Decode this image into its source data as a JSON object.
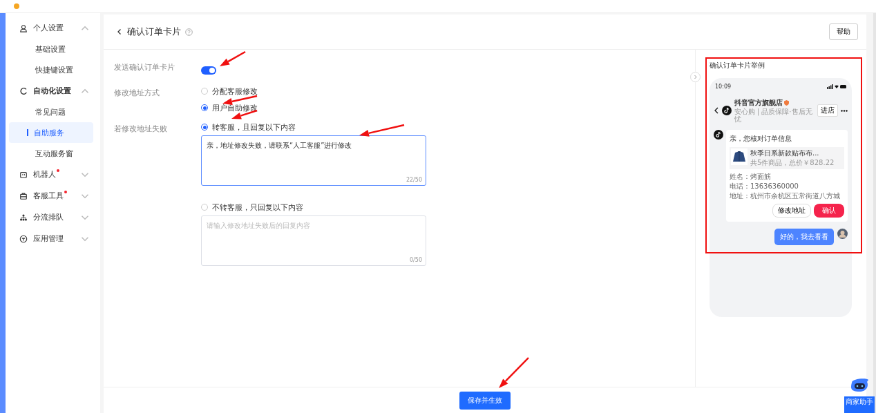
{
  "sidebar": {
    "groups": [
      {
        "label": "个人设置",
        "expanded": true,
        "dot": false,
        "children": [
          {
            "label": "基础设置",
            "selected": false
          },
          {
            "label": "快捷键设置",
            "selected": false
          }
        ]
      },
      {
        "label": "自动化设置",
        "expanded": true,
        "dot": false,
        "children": [
          {
            "label": "常见问题",
            "selected": false
          },
          {
            "label": "自助服务",
            "selected": true
          },
          {
            "label": "互动服务窗",
            "selected": false
          }
        ]
      },
      {
        "label": "机器人",
        "expanded": false,
        "dot": true
      },
      {
        "label": "客服工具",
        "expanded": false,
        "dot": true
      },
      {
        "label": "分流排队",
        "expanded": false,
        "dot": false
      },
      {
        "label": "应用管理",
        "expanded": false,
        "dot": false
      }
    ]
  },
  "header": {
    "title": "确认订单卡片",
    "help": "帮助"
  },
  "form": {
    "toggle": {
      "label": "发送确认订单卡片",
      "on": true
    },
    "address_method": {
      "label": "修改地址方式",
      "options": [
        {
          "label": "分配客服修改",
          "selected": false
        },
        {
          "label": "用户自助修改",
          "selected": true
        }
      ]
    },
    "failure": {
      "label": "若修改地址失败",
      "options": [
        {
          "label": "转客服，且回复以下内容",
          "selected": true,
          "value": "亲，地址修改失败，请联系“人工客服”进行修改",
          "count": "22/50"
        },
        {
          "label": "不转客服，只回复以下内容",
          "selected": false,
          "placeholder": "请输入修改地址失败后的回复内容",
          "count": "0/50"
        }
      ]
    }
  },
  "preview": {
    "title": "确认订单卡片举例",
    "time": "10:09",
    "store": "抖音官方旗舰店",
    "store_sub": "安心购 | 品质保障·售后无忧",
    "enter": "进店",
    "greeting": "亲，您核对订单信息",
    "product": "秋季日系新款贴布布...",
    "summary": "共5件商品，总价￥828.22",
    "fields": [
      "姓名：烤面筋",
      "电话：13636360000",
      "地址：杭州市余杭区五常街道八方城"
    ],
    "modify": "修改地址",
    "confirm": "确认",
    "reply": "好的，我去看看"
  },
  "footer": {
    "save": "保存并生效"
  },
  "assistant": {
    "label": "商家助手"
  }
}
